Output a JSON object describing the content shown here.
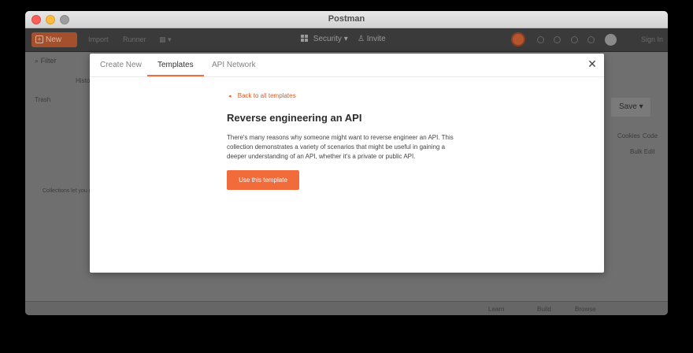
{
  "window": {
    "title": "Postman"
  },
  "header": {
    "new_label": "New",
    "import_label": "Import",
    "runner_label": "Runner",
    "workspace_label": "Security",
    "invite_label": "Invite",
    "signin_label": "Sign In"
  },
  "background": {
    "search_placeholder": "Filter",
    "history_label": "History",
    "trash_label": "Trash",
    "empty_hint": "Collections let you group related requests",
    "save_label": "Save",
    "cookies_label": "Cookies",
    "code_label": "Code",
    "bulk_edit_label": "Bulk Edit",
    "learn_label": "Learn",
    "build_label": "Build",
    "browse_label": "Browse"
  },
  "modal": {
    "tabs": [
      {
        "label": "Create New"
      },
      {
        "label": "Templates"
      },
      {
        "label": "API Network"
      }
    ],
    "active_tab": "Templates",
    "back_link": "Back to all templates",
    "template_title": "Reverse engineering an API",
    "template_description": "There's many reasons why someone might want to reverse engineer an API. This collection demonstrates a variety of scenarios that might be useful in gaining a deeper understanding of an API, whether it's a private or public API.",
    "use_button": "Use this template",
    "close_icon": "close-icon"
  },
  "colors": {
    "accent": "#f26b3a",
    "link": "#e05a24",
    "overlay": "#6f6f6f"
  }
}
